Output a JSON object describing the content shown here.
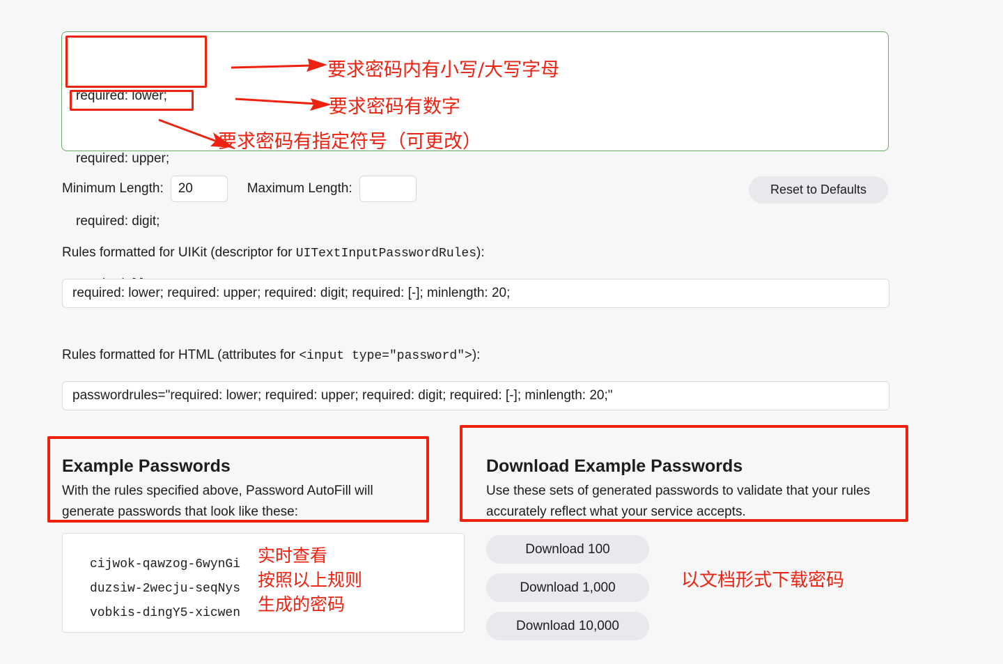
{
  "rules_editor": {
    "lines": [
      "required: lower;",
      "required: upper;",
      "required: digit;",
      "required: [-];"
    ]
  },
  "annotations": [
    {
      "id": "lower-upper",
      "text": "要求密码内有小写/大写字母"
    },
    {
      "id": "digit",
      "text": "要求密码有数字"
    },
    {
      "id": "symbol",
      "text": "要求密码有指定符号（可更改）"
    },
    {
      "id": "live-preview-1",
      "text": "实时查看"
    },
    {
      "id": "live-preview-2",
      "text": "按照以上规则"
    },
    {
      "id": "live-preview-3",
      "text": "生成的密码"
    },
    {
      "id": "download-doc",
      "text": "以文档形式下载密码"
    }
  ],
  "length_row": {
    "minimum_label": "Minimum Length:",
    "minimum_value": "20",
    "maximum_label": "Maximum Length:",
    "maximum_value": "",
    "maximum_placeholder": ""
  },
  "reset_button": {
    "label": "Reset to Defaults"
  },
  "uikit_section": {
    "label_prefix": "Rules formatted for UIKit (descriptor for ",
    "label_code": "UITextInputPasswordRules",
    "label_suffix": "):",
    "value": "required: lower; required: upper; required: digit; required: [-]; minlength: 20;"
  },
  "html_section": {
    "label_prefix": "Rules formatted for HTML (attributes for ",
    "label_code": "<input type=\"password\">",
    "label_suffix": "):",
    "value": "passwordrules=\"required: lower; required: upper; required: digit; required: [-]; minlength: 20;\""
  },
  "example_card": {
    "title": "Example Passwords",
    "body": "With the rules specified above, Password AutoFill will generate passwords that look like these:",
    "passwords": [
      "cijwok-qawzog-6wynGi",
      "duzsiw-2wecju-seqNys",
      "vobkis-dingY5-xicwen"
    ]
  },
  "download_card": {
    "title": "Download Example Passwords",
    "body": "Use these sets of generated passwords to validate that your rules accurately reflect what your service accepts.",
    "buttons": [
      {
        "label": "Download 100"
      },
      {
        "label": "Download 1,000"
      },
      {
        "label": "Download 10,000"
      }
    ]
  },
  "colors": {
    "page_background": "#f7f7f7",
    "annotation_red": "#ee2211",
    "editor_border_green": "#6aab6a",
    "button_gray": "#e8e8ed",
    "text": "#1d1d1f"
  }
}
